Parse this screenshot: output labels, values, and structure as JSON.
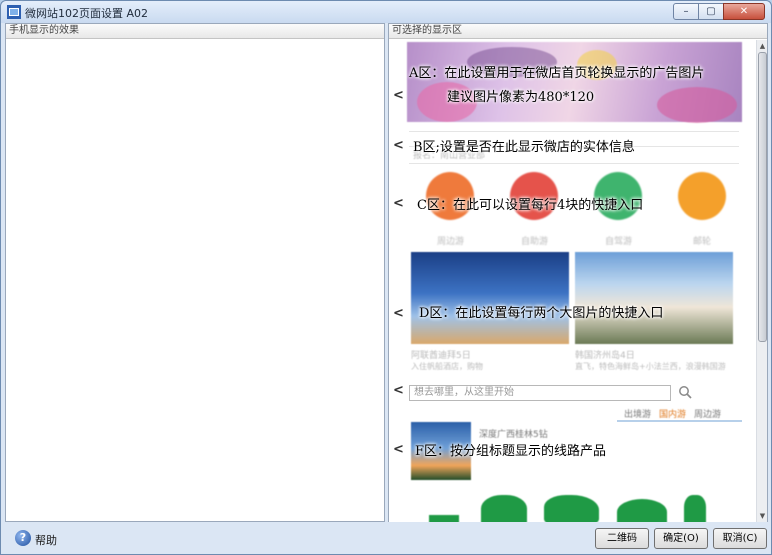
{
  "window": {
    "title": "微网站102页面设置 A02",
    "controls": {
      "minimize": "–",
      "maximize": "▢",
      "close": "✕"
    }
  },
  "left_panel": {
    "header": "手机显示的效果"
  },
  "right_panel": {
    "header": "可选择的显示区",
    "arrow": "<",
    "zones": {
      "a": {
        "line1": "A区：在此设置用于在微店首页轮换显示的广告图片",
        "line2": "建议图片像素为480*120"
      },
      "b": {
        "text": "B区;设置是否在此显示微店的实体信息",
        "blur_line": "报名：南山营业部"
      },
      "c": {
        "text": "C区：在此可以设置每行4块的快捷入口",
        "items": [
          "周边游",
          "自助游",
          "自驾游",
          "邮轮"
        ]
      },
      "d": {
        "text": "D区：在此设置每行两个大图片的快捷入口",
        "captions": [
          "阿联酋迪拜5日",
          "韩国济州岛4日"
        ],
        "subcaptions": [
          "入住帆船酒店，购物",
          "直飞，特色海鲜岛+小法兰西，浪漫韩国游"
        ]
      },
      "e": {
        "search_placeholder": "想去哪里，从这里开始",
        "tabs": [
          "出境游",
          "国内游",
          "周边游"
        ]
      },
      "f": {
        "text": "F区：按分组标题显示的线路产品",
        "product_title": "深度广西桂林5钻"
      }
    }
  },
  "footer": {
    "help": "帮助",
    "buttons": {
      "qr": "二维码",
      "ok": "确定(O)",
      "cancel": "取消(C)"
    }
  },
  "colors": {
    "accent": "#e07a20",
    "zone_c_circles": [
      "#ef7a3c",
      "#e5534b",
      "#3fb46e",
      "#f4a02b"
    ]
  }
}
